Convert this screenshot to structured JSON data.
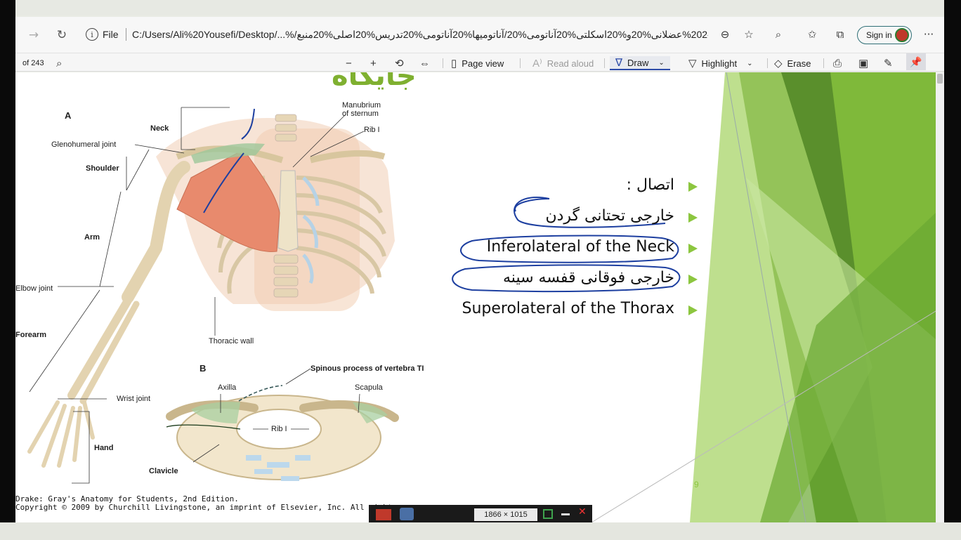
{
  "browser": {
    "file_label": "File",
    "url": "C:/Users/Ali%20Yousefi/Desktop/...%/تدریس%99-400-202%عضلانی%20و%20اسکلتی%20آناتومی%20/آناتومیها%20آناتومی%20تدریس%20اصلی%20منبع",
    "signin_label": "Sign in",
    "more_label": "···"
  },
  "pdf_toolbar": {
    "page_count": "of 243",
    "page_view": "Page view",
    "read_aloud": "Read aloud",
    "draw": "Draw",
    "highlight": "Highlight",
    "erase": "Erase"
  },
  "slide": {
    "title": "جایگاه",
    "bullets": [
      {
        "text": "اتصال :",
        "rtl": true
      },
      {
        "text": "خارجی تحتانی گردن",
        "rtl": true
      },
      {
        "text": "Inferolateral of the Neck",
        "rtl": false
      },
      {
        "text": "خارجی فوقانی قفسه سینه",
        "rtl": true
      },
      {
        "text": "Superolateral of the Thorax",
        "rtl": false
      }
    ],
    "page_number": "9",
    "accent_color": "#8cc63f"
  },
  "figure": {
    "letter_a": "A",
    "letter_b": "B",
    "labels_a": {
      "manubrium": "Manubrium\nof sternum",
      "rib1": "Rib I",
      "neck": "Neck",
      "glenohumeral": "Glenohumeral joint",
      "shoulder": "Shoulder",
      "arm": "Arm",
      "elbow": "Elbow joint",
      "forearm": "Forearm",
      "wrist": "Wrist joint",
      "hand": "Hand",
      "thoracic_wall": "Thoracic wall"
    },
    "labels_b": {
      "spinous": "Spinous process of vertebra TI",
      "axilla": "Axilla",
      "scapula": "Scapula",
      "rib1": "Rib I",
      "clavicle": "Clavicle"
    },
    "credit_line1": "Drake: Gray's Anatomy for Students, 2nd Edition.",
    "credit_line2": "Copyright © 2009 by Churchill Livingstone, an imprint of Elsevier, Inc. All right"
  },
  "snip_tool": {
    "dimensions": "1866 × 1015"
  }
}
